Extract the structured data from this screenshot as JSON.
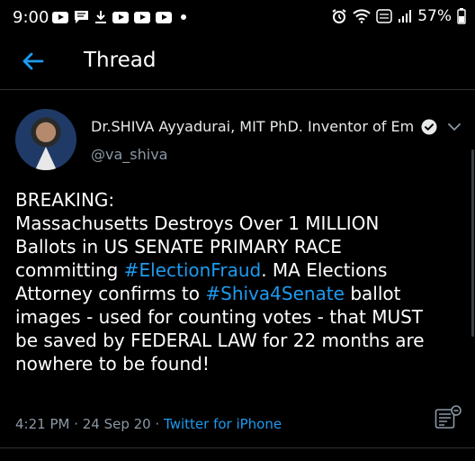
{
  "status_bar": {
    "time": "9:00",
    "battery": "57%",
    "notification_icons": [
      "youtube-icon",
      "message-icon",
      "download-icon",
      "youtube-icon",
      "youtube-icon",
      "youtube-icon",
      "dot-icon"
    ],
    "system_icons": [
      "alarm-icon",
      "wifi-icon",
      "volte-icon",
      "signal-icon",
      "battery-icon"
    ]
  },
  "header": {
    "back_icon": "arrow-left-icon",
    "title": "Thread"
  },
  "tweet": {
    "author_name": "Dr.SHIVA Ayyadurai, MIT PhD. Inventor of Em…",
    "handle": "@va_shiva",
    "text_lines": [
      [
        {
          "t": "BREAKING:"
        }
      ],
      [
        {
          "t": "Massachusetts Destroys Over 1 MILLION"
        }
      ],
      [
        {
          "t": "Ballots in US SENATE PRIMARY RACE"
        }
      ],
      [
        {
          "t": "committing "
        },
        {
          "t": "#ElectionFraud",
          "h": true
        },
        {
          "t": ".  MA Elections"
        }
      ],
      [
        {
          "t": "Attorney confirms to "
        },
        {
          "t": "#Shiva4Senate",
          "h": true
        },
        {
          "t": " ballot"
        }
      ],
      [
        {
          "t": "images -  used for counting votes - that MUST"
        }
      ],
      [
        {
          "t": "be saved by FEDERAL LAW for 22 months are"
        }
      ],
      [
        {
          "t": "nowhere to be found!"
        }
      ]
    ],
    "timestamp": "4:21 PM · 24 Sep 20 · ",
    "source": "Twitter for iPhone"
  },
  "colors": {
    "background": "#000000",
    "accent": "#1d9bf0",
    "secondary_text": "#8b98a5"
  }
}
